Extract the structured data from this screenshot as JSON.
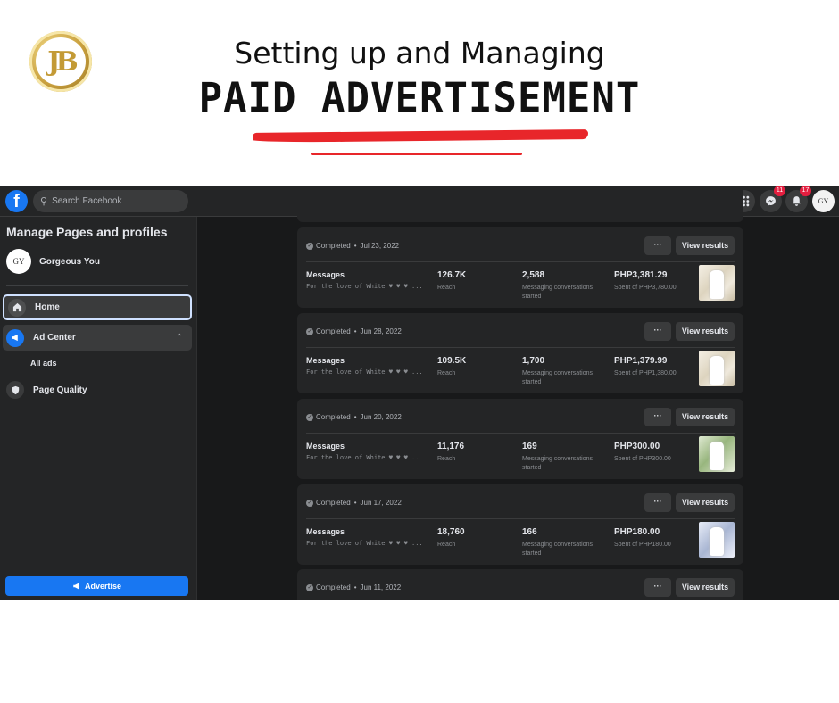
{
  "banner": {
    "logo_text": "JB",
    "headline_1": "Setting up and Managing",
    "headline_2": "PAID ADVERTISEMENT"
  },
  "fb": {
    "search_placeholder": "Search Facebook",
    "nav_icons": [
      "home-icon",
      "flag-icon",
      "insights-icon",
      "megaphone-icon"
    ],
    "right": {
      "messenger_badge": "11",
      "notifications_badge": "17",
      "avatar_text": "GY"
    },
    "sidebar": {
      "title": "Manage Pages and profiles",
      "page_avatar": "GY",
      "page_name": "Gorgeous You",
      "home": "Home",
      "ad_center": "Ad Center",
      "all_ads": "All ads",
      "page_quality": "Page Quality",
      "advertise": "Advertise"
    },
    "cards": [
      {
        "status": "Completed",
        "date": "Jul 23, 2022",
        "more": "···",
        "view": "View results",
        "objective": "Messages",
        "ad_name": "For the love of White ♥ ♥ ♥ ...",
        "reach": "126.7K",
        "reach_label": "Reach",
        "messaging": "2,588",
        "messaging_label": "Messaging conversations started",
        "spent": "PHP3,381.29",
        "spent_label": "Spent of PHP3,780.00",
        "thumb": "white"
      },
      {
        "status": "Completed",
        "date": "Jun 28, 2022",
        "more": "···",
        "view": "View results",
        "objective": "Messages",
        "ad_name": "For the love of White ♥ ♥ ♥ ...",
        "reach": "109.5K",
        "reach_label": "Reach",
        "messaging": "1,700",
        "messaging_label": "Messaging conversations started",
        "spent": "PHP1,379.99",
        "spent_label": "Spent of PHP1,380.00",
        "thumb": "white"
      },
      {
        "status": "Completed",
        "date": "Jun 20, 2022",
        "more": "···",
        "view": "View results",
        "objective": "Messages",
        "ad_name": "For the love of White ♥ ♥ ♥ ...",
        "reach": "11,176",
        "reach_label": "Reach",
        "messaging": "169",
        "messaging_label": "Messaging conversations started",
        "spent": "PHP300.00",
        "spent_label": "Spent of PHP300.00",
        "thumb": "green"
      },
      {
        "status": "Completed",
        "date": "Jun 17, 2022",
        "more": "···",
        "view": "View results",
        "objective": "Messages",
        "ad_name": "For the love of White ♥ ♥ ♥ ...",
        "reach": "18,760",
        "reach_label": "Reach",
        "messaging": "166",
        "messaging_label": "Messaging conversations started",
        "spent": "PHP180.00",
        "spent_label": "Spent of PHP180.00",
        "thumb": "blue"
      },
      {
        "status": "Completed",
        "date": "Jun 11, 2022",
        "more": "···",
        "view": "View results"
      }
    ],
    "colors": {
      "accent": "#1877f2",
      "background": "#18191a",
      "card": "#242526",
      "badge": "#e41e3f"
    }
  }
}
